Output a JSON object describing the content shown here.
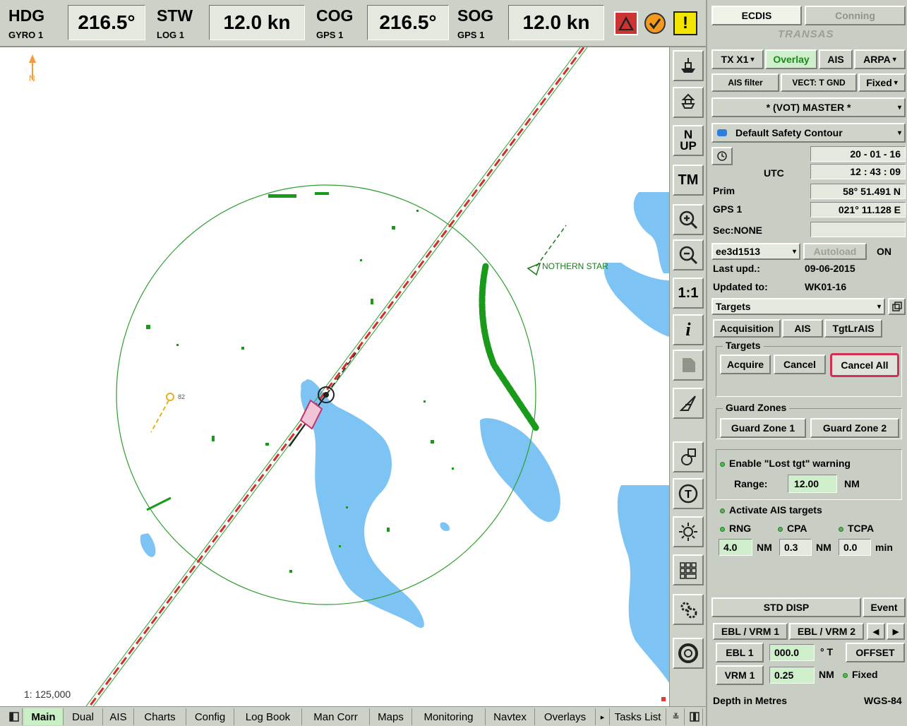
{
  "topbar": {
    "hdg": {
      "label": "HDG",
      "src": "GYRO 1",
      "value": "216.5°"
    },
    "stw": {
      "label": "STW",
      "src": "LOG 1",
      "value": "12.0 kn"
    },
    "cog": {
      "label": "COG",
      "src": "GPS 1",
      "value": "216.5°"
    },
    "sog": {
      "label": "SOG",
      "src": "GPS 1",
      "value": "12.0 kn"
    },
    "alarm_icons": [
      "red-triangle-icon",
      "orange-check-icon",
      "yellow-exclamation-icon"
    ],
    "alarm_text": "!"
  },
  "map": {
    "target_label": "NOTHERN STAR",
    "waypoint_label": "82",
    "north_label": "N",
    "scale": "1: 125,000",
    "colors": {
      "water": "#7dc4f5",
      "radar": "#1a9a1a",
      "route": "#d62b2b",
      "ring": "#2e9e2e"
    }
  },
  "toolbar": {
    "items": [
      {
        "name": "own-ship-icon",
        "glyph": "⛴"
      },
      {
        "name": "center-ship-icon",
        "glyph": "⛴"
      },
      {
        "name": "north-up-icon",
        "glyph": "N\nUP"
      },
      {
        "name": "true-motion-icon",
        "glyph": "TM"
      },
      {
        "name": "zoom-in-icon",
        "glyph": "⊕"
      },
      {
        "name": "zoom-out-icon",
        "glyph": "⊖"
      },
      {
        "name": "scale-1-1-icon",
        "glyph": "1:1"
      },
      {
        "name": "info-icon",
        "glyph": "i"
      },
      {
        "name": "doc-icon",
        "glyph": "▮"
      },
      {
        "name": "ruler-icon",
        "glyph": "⟋"
      },
      {
        "name": "route-tool-icon",
        "glyph": "♙"
      },
      {
        "name": "t-icon",
        "glyph": "Ⓣ"
      },
      {
        "name": "brightness-icon",
        "glyph": "☼"
      },
      {
        "name": "keypad-icon",
        "glyph": "▦"
      },
      {
        "name": "settings-icon",
        "glyph": "⚙"
      },
      {
        "name": "lifebuoy-icon",
        "glyph": "◎"
      }
    ]
  },
  "panel": {
    "tab_ecdis": "ECDIS",
    "tab_conning": "Conning",
    "brand": "TRANSAS",
    "tx": "TX X1",
    "overlay": "Overlay",
    "ais": "AIS",
    "arpa": "ARPA",
    "ais_filter": "AIS filter",
    "vect": "VECT: T GND",
    "fixed_sel": "Fixed",
    "master": "* (VOT) MASTER *",
    "safety_contour": "Default Safety Contour",
    "date": "20 - 01 - 16",
    "time": "12 : 43 : 09",
    "utc": "UTC",
    "prim": "Prim",
    "gps1": "GPS 1",
    "lat": "58° 51.491 N",
    "lon": "021° 11.128 E",
    "sec": "Sec:NONE",
    "chart_id": "ee3d1513",
    "autoload": "Autoload",
    "on": "ON",
    "last_upd_label": "Last upd.:",
    "last_upd": "09-06-2015",
    "updated_to_label": "Updated to:",
    "updated_to": "WK01-16",
    "targets_sel": "Targets",
    "subtabs": [
      "Acquisition",
      "AIS",
      "TgtLrAIS"
    ],
    "targets_group": "Targets",
    "acquire": "Acquire",
    "cancel": "Cancel",
    "cancel_all": "Cancel All",
    "guard_group": "Guard Zones",
    "gz1": "Guard Zone 1",
    "gz2": "Guard Zone 2",
    "lost_tgt": "Enable \"Lost tgt\" warning",
    "range_label": "Range:",
    "range": "12.00",
    "nm": "NM",
    "activate_ais": "Activate AIS targets",
    "rng": "RNG",
    "cpa": "CPA",
    "tcpa": "TCPA",
    "rng_val": "4.0",
    "cpa_val": "0.3",
    "tcpa_val": "0.0",
    "min": "min",
    "std_disp": "STD DISP",
    "event": "Event",
    "ebl_tab1": "EBL / VRM 1",
    "ebl_tab2": "EBL / VRM 2",
    "ebl1": "EBL 1",
    "ebl_val": "000.0",
    "deg_t": "° T",
    "offset": "OFFSET",
    "vrm1": "VRM 1",
    "vrm_val": "0.25",
    "fixed": "Fixed",
    "depth": "Depth in Metres",
    "wgs": "WGS-84"
  },
  "bottom_tabs": [
    "Main",
    "Dual",
    "AIS",
    "Charts",
    "Config",
    "Log Book",
    "Man Corr",
    "Maps",
    "Monitoring",
    "Navtex",
    "Overlays",
    "Tasks List"
  ]
}
